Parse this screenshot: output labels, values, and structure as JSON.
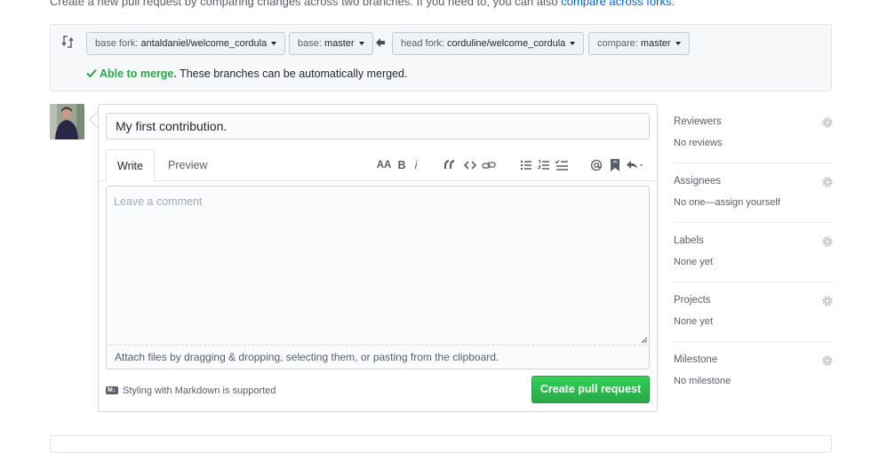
{
  "intro": {
    "text": "Create a new pull request by comparing changes across two branches. If you need to, you can also ",
    "link": "compare across forks."
  },
  "range": {
    "base_fork_label": "base fork: ",
    "base_fork_value": "antaldaniel/welcome_cordula",
    "base_label": "base: ",
    "base_value": "master",
    "head_fork_label": "head fork: ",
    "head_fork_value": "corduline/welcome_cordula",
    "compare_label": "compare: ",
    "compare_value": "master",
    "merge_status": "Able to merge.",
    "merge_detail": " These branches can be automatically merged."
  },
  "composer": {
    "title_value": "My first contribution.",
    "tabs": [
      "Write",
      "Preview"
    ],
    "toolbar": {
      "header": "AA",
      "bold": "B",
      "italic": "i"
    },
    "comment_placeholder": "Leave a comment",
    "attach_hint": "Attach files by dragging & dropping, selecting them, or pasting from the clipboard.",
    "markdown_note": "Styling with Markdown is supported",
    "markdown_badge": "M↓",
    "submit_label": "Create pull request"
  },
  "sidebar": [
    {
      "title": "Reviewers",
      "value": "No reviews"
    },
    {
      "title": "Assignees",
      "value": "No one—assign yourself"
    },
    {
      "title": "Labels",
      "value": "None yet"
    },
    {
      "title": "Projects",
      "value": "None yet"
    },
    {
      "title": "Milestone",
      "value": "No milestone"
    }
  ],
  "colors": {
    "link": "#0366d6",
    "success": "#28a745",
    "button_green": "#2cbe4e",
    "muted": "#586069"
  },
  "icons": [
    "git-compare-icon",
    "caret-down-icon",
    "arrow-left-icon",
    "check-icon",
    "gear-icon",
    "markdown-icon"
  ]
}
